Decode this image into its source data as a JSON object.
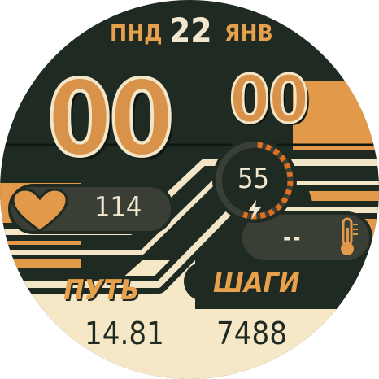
{
  "date": {
    "weekday": "ПНД",
    "day": "22",
    "month": "ЯНВ"
  },
  "time": {
    "hours": "00",
    "minutes": "00"
  },
  "battery": {
    "value": "55",
    "icon": "bolt-icon"
  },
  "heart": {
    "value": "114",
    "icon": "heart-icon"
  },
  "temperature": {
    "value": "--",
    "icon": "thermometer-icon"
  },
  "distance": {
    "label": "ПУТЬ",
    "value": "14.81"
  },
  "steps": {
    "label": "ШАГИ",
    "value": "7488"
  },
  "colors": {
    "background": "#1f2a22",
    "accent": "#e7a04c",
    "cream": "#f3e6c8",
    "panel": "#3a3f36"
  }
}
